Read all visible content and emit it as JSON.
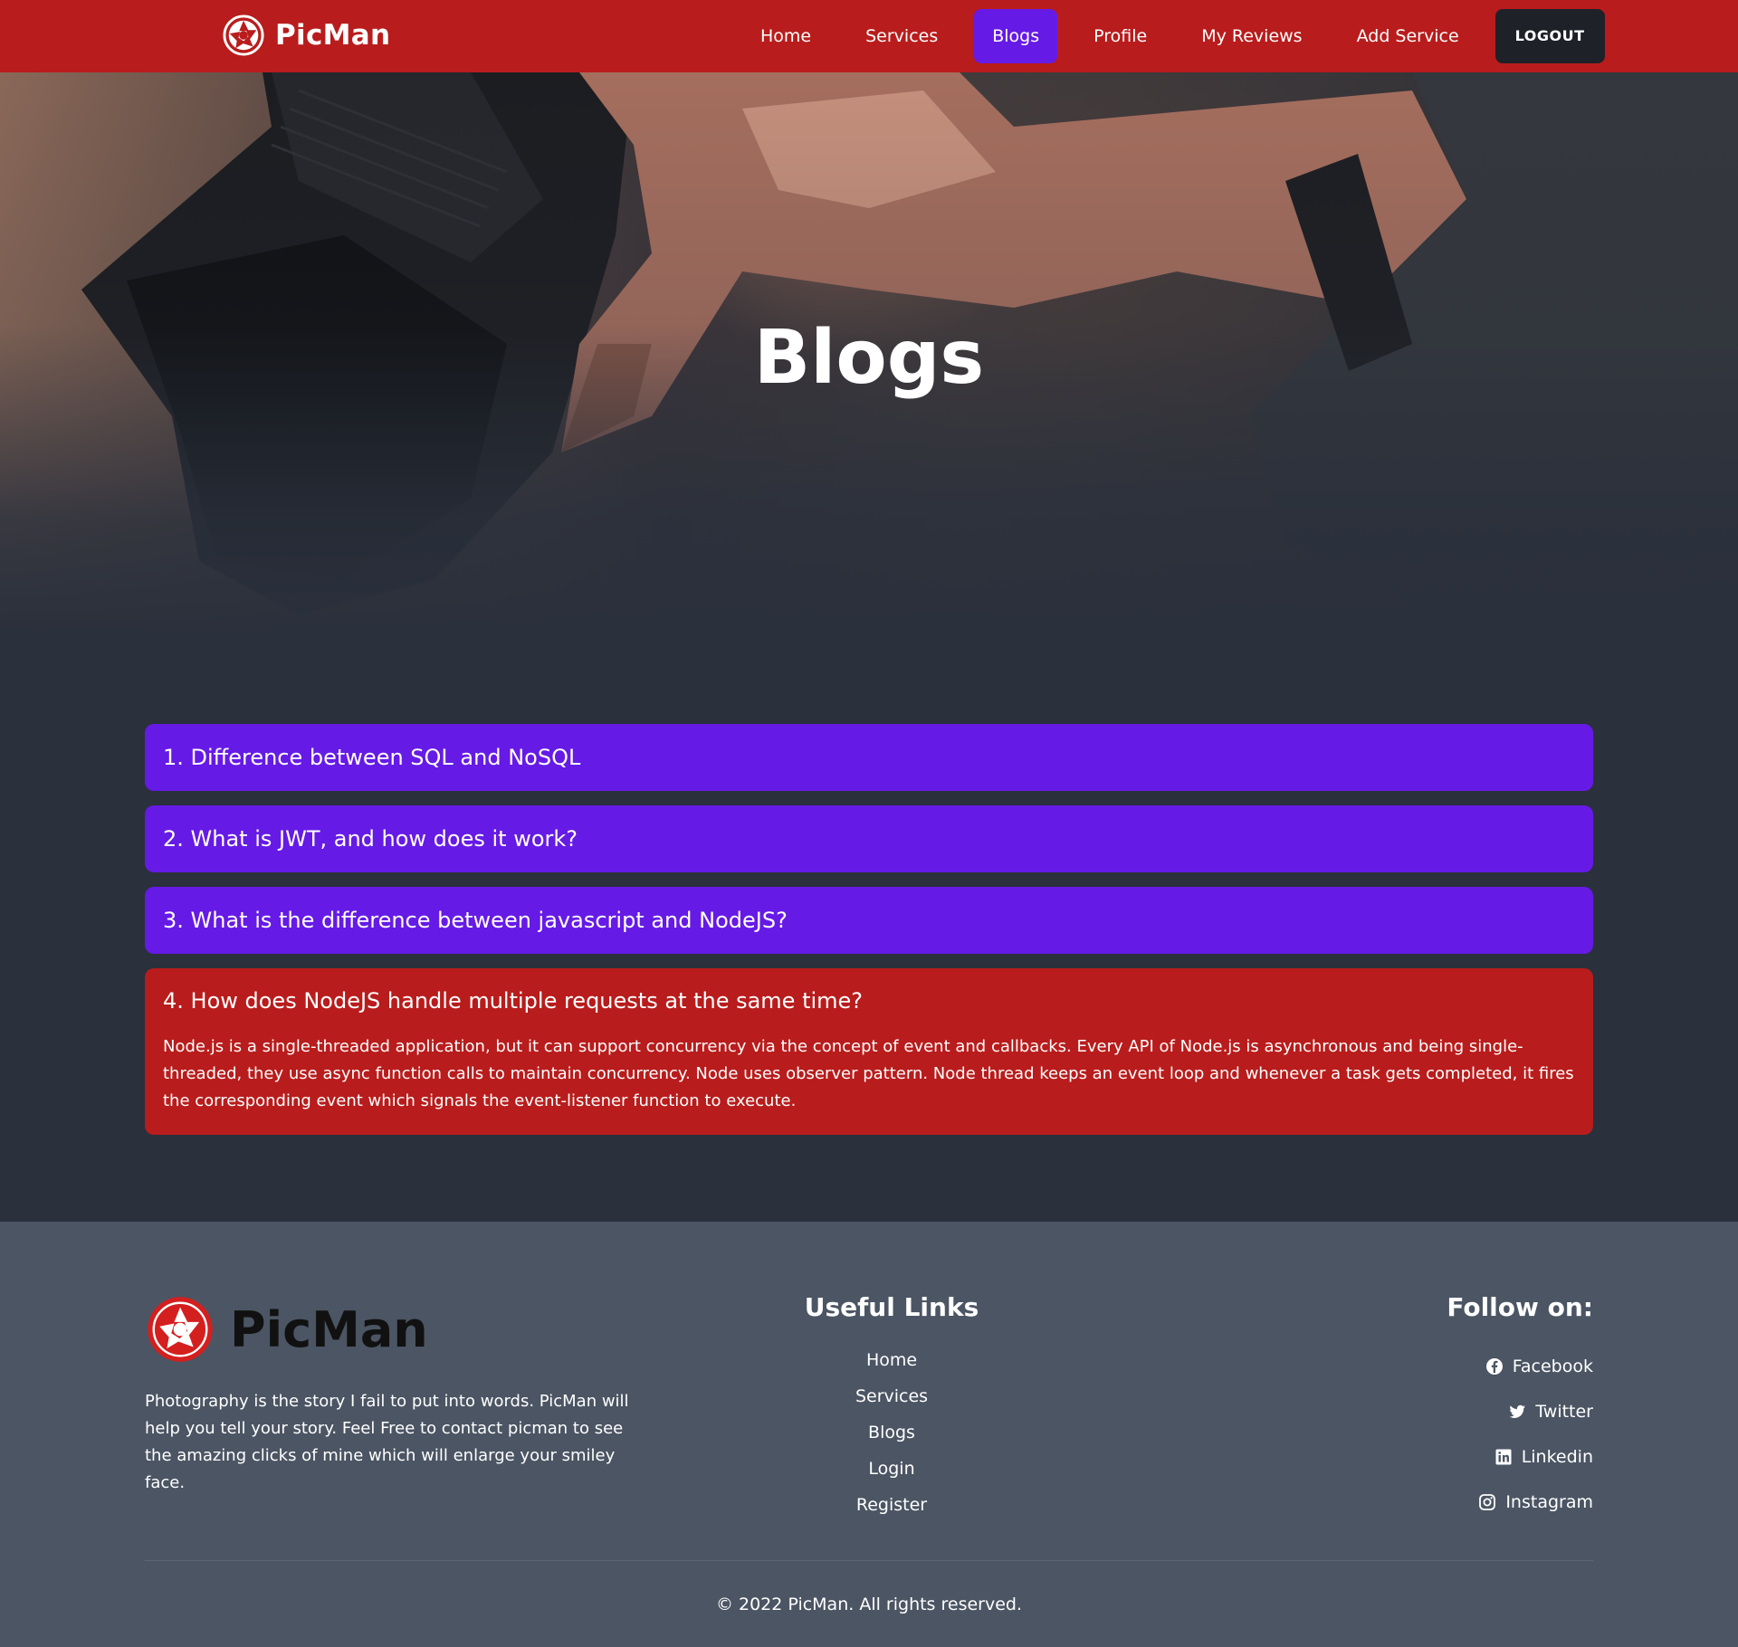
{
  "brand": {
    "name": "PicMan"
  },
  "nav": {
    "items": [
      {
        "label": "Home"
      },
      {
        "label": "Services"
      },
      {
        "label": "Blogs",
        "active": true
      },
      {
        "label": "Profile"
      },
      {
        "label": "My Reviews"
      },
      {
        "label": "Add Service"
      }
    ],
    "logout_label": "LOGOUT"
  },
  "hero": {
    "title": "Blogs"
  },
  "blogs": [
    {
      "question": "1. Difference between SQL and NoSQL",
      "expanded": false
    },
    {
      "question": "2. What is JWT, and how does it work?",
      "expanded": false
    },
    {
      "question": "3. What is the difference between javascript and NodeJS?",
      "expanded": false
    },
    {
      "question": "4. How does NodeJS handle multiple requests at the same time?",
      "expanded": true,
      "answer": "Node.js is a single-threaded application, but it can support concurrency via the concept of event and callbacks. Every API of Node.js is asynchronous and being single-threaded, they use async function calls to maintain concurrency. Node uses observer pattern. Node thread keeps an event loop and whenever a task gets completed, it fires the corresponding event which signals the event-listener function to execute."
    }
  ],
  "footer": {
    "brand_name": "PicMan",
    "description": "Photography is the story I fail to put into words. PicMan will help you tell your story. Feel Free to contact picman to see the amazing clicks of mine which will enlarge your smiley face.",
    "useful_links": {
      "heading": "Useful Links",
      "items": [
        "Home",
        "Services",
        "Blogs",
        "Login",
        "Register"
      ]
    },
    "follow": {
      "heading": "Follow on:",
      "items": [
        {
          "label": "Facebook",
          "icon": "facebook-icon"
        },
        {
          "label": "Twitter",
          "icon": "twitter-icon"
        },
        {
          "label": "Linkedin",
          "icon": "linkedin-icon"
        },
        {
          "label": "Instagram",
          "icon": "instagram-icon"
        }
      ]
    },
    "copyright": "© 2022 PicMan. All rights reserved."
  },
  "colors": {
    "primary_red": "#b91c1c",
    "accent_purple": "#661ae6",
    "page_background": "#2a303c",
    "footer_background": "#4b5563",
    "logout_button": "#1f2129"
  }
}
